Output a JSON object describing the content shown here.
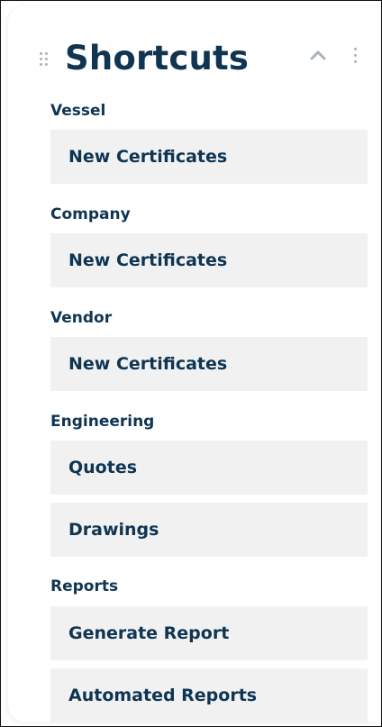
{
  "widget": {
    "title": "Shortcuts",
    "icons": {
      "drag": "drag-handle-icon",
      "collapse": "chevron-up-icon",
      "menu": "kebab-menu-icon"
    }
  },
  "sections": [
    {
      "title": "Vessel",
      "items": [
        {
          "label": "New Certificates"
        }
      ]
    },
    {
      "title": "Company",
      "items": [
        {
          "label": "New Certificates"
        }
      ]
    },
    {
      "title": "Vendor",
      "items": [
        {
          "label": "New Certificates"
        }
      ]
    },
    {
      "title": "Engineering",
      "items": [
        {
          "label": "Quotes"
        },
        {
          "label": "Drawings"
        }
      ]
    },
    {
      "title": "Reports",
      "items": [
        {
          "label": "Generate Report"
        },
        {
          "label": "Automated Reports"
        }
      ]
    }
  ],
  "colors": {
    "text": "#0f3553",
    "item_bg": "#f1f1f1",
    "icon": "#a9b3bd"
  }
}
